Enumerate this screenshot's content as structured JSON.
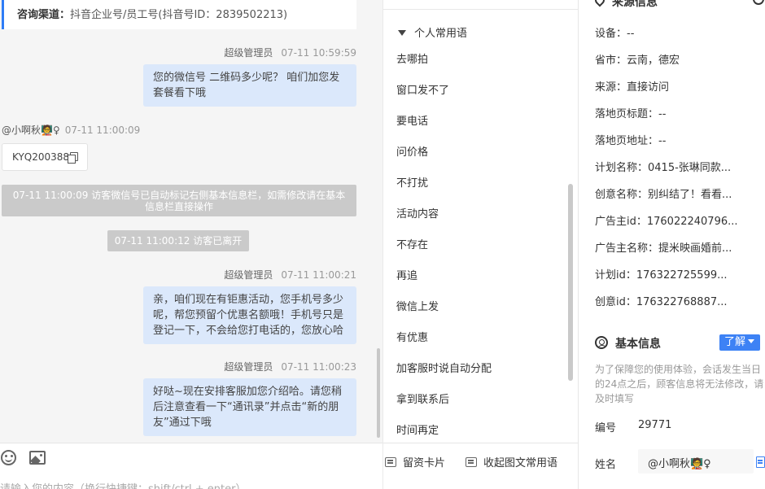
{
  "chat": {
    "channel": {
      "label": "咨询渠道：",
      "value": "抖音企业号/员工号(抖音号ID：2839502213)"
    },
    "messages": [
      {
        "sender": "超级管理员",
        "time": "07-11 10:59:59",
        "text": "您的微信号 二维码多少呢？ 咱们加您发套餐看下哦"
      },
      {
        "sender": "@小啊秋🧑‍🏫♀",
        "time": "07-11 11:00:09",
        "text": "KYQ200388"
      },
      {
        "system": "07-11 11:00:09 访客微信号已自动标记右侧基本信息栏，如需修改请在基本信息栏直接操作"
      },
      {
        "system": "07-11 11:00:12 访客已离开"
      },
      {
        "sender": "超级管理员",
        "time": "07-11 11:00:21",
        "text": "亲，咱们现在有钜惠活动，您手机号多少呢，帮您预留个优惠名额哦！手机号只是登记一下，不会给您打电话的，您放心哈"
      },
      {
        "sender": "超级管理员",
        "time": "07-11 11:00:23",
        "text": "好哒~现在安排客服加您介绍哈。请您稍后注意查看一下“通讯录”并点击“新的朋友”通过下哦"
      }
    ],
    "toolbar": {
      "emoji_icon": "smile-icon",
      "image_icon": "image-icon"
    },
    "input_placeholder": "请输入您的内容（换行快捷键：shift/ctrl + enter）"
  },
  "phrases": {
    "group_title": "个人常用语",
    "items": [
      "去哪拍",
      "窗口发不了",
      "要电话",
      "问价格",
      "不打扰",
      "活动内容",
      "不存在",
      "再追",
      "微信上发",
      "有优惠",
      "加客服时说自动分配",
      "拿到联系后",
      "时间再定"
    ],
    "toolbar": {
      "card_label": "留资卡片",
      "collapse_label": "收起图文常用语"
    }
  },
  "info": {
    "source": {
      "title": "来源信息",
      "items": [
        "设备：--",
        "省市：云南，德宏",
        "来源：直接访问",
        "落地页标题：--",
        "落地页地址：--",
        "计划名称：0415-张琳同款...",
        "创意名称：别纠结了！看看...",
        "广告主id：176022240796...",
        "广告主名称：提米映画婚前...",
        "计划id：176322725599...",
        "创意id：176322768887..."
      ]
    },
    "basic": {
      "title": "基本信息",
      "dropdown_label": "了解",
      "notice": "为了保障您的使用体验，会话发生当日的24点之后，顾客信息将无法修改，请及时填写",
      "id_label": "编号",
      "id_value": "29771",
      "name_label": "姓名",
      "name_value": "@小啊秋🧑‍🏫♀"
    }
  },
  "colors": {
    "accent": "#3d82f5",
    "bubble": "#dbe8fb",
    "system": "#cacaca"
  }
}
